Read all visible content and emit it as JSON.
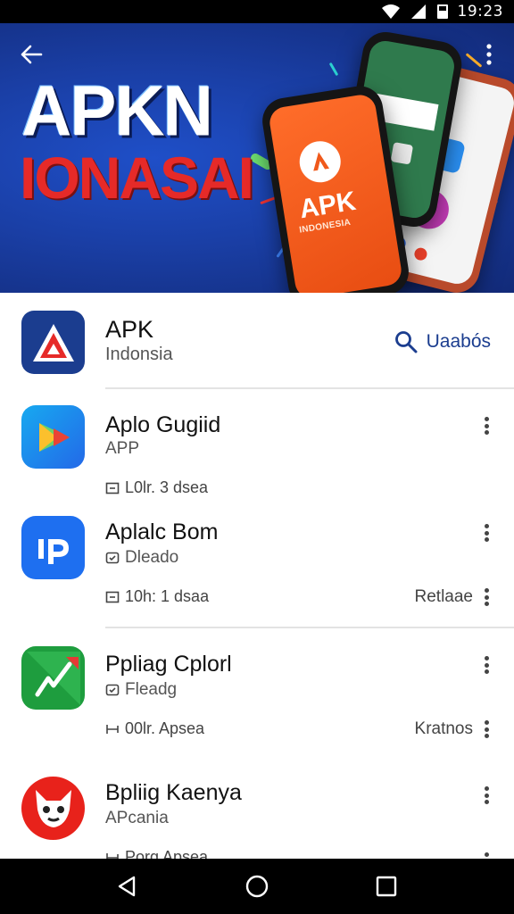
{
  "status_bar": {
    "time": "19:23",
    "icons": [
      "wifi-icon",
      "signal-icon",
      "sim-icon",
      "battery-icon"
    ]
  },
  "hero": {
    "title_line1": "APKN",
    "title_line2": "IONASAI",
    "phone_brand": "APK",
    "phone_sub": "INDONESIA"
  },
  "header": {
    "title": "APK",
    "subtitle": "Indonsia",
    "search_label": "Uaabós"
  },
  "apps": [
    {
      "name": "Aplo Gugiid",
      "sub": "APP",
      "meta": "L0lr. 3 dsea",
      "action": "",
      "icon": "play-triangle-icon"
    },
    {
      "name": "Aplalc Bom",
      "sub": "Dleado",
      "meta": "10h: 1 dsaa",
      "action": "Retlaae",
      "icon": "ip-logo-icon"
    },
    {
      "name": "Ppliag Cplorl",
      "sub": "Fleadg",
      "meta": "00lr. Apsea",
      "action": "Kratnos",
      "icon": "arrow-logo-icon"
    },
    {
      "name": "Bpliig Kaenya",
      "sub": "APcania",
      "meta": "Porg Apsea",
      "action": "",
      "icon": "fox-logo-icon"
    }
  ],
  "colors": {
    "accent": "#1b3d8f",
    "hero_red": "#e62a28",
    "phone_orange": "#f0591b"
  }
}
